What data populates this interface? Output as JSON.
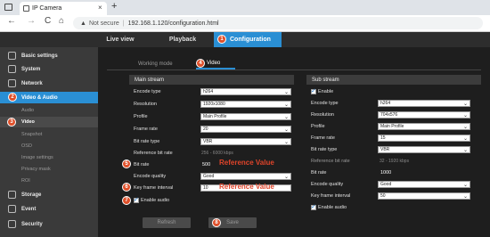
{
  "browser": {
    "tab_title": "IP Camera",
    "tab_close": "×",
    "new_tab": "+",
    "back": "←",
    "forward": "→",
    "reload": "C",
    "home": "⌂",
    "warn": "▲",
    "not_secure": "Not secure",
    "separator": "|",
    "url": "192.168.1.120/configuration.html"
  },
  "topnav": {
    "items": [
      {
        "label": "Live view"
      },
      {
        "label": "Playback"
      },
      {
        "label": "Configuration",
        "marker": "1"
      }
    ]
  },
  "sidebar": {
    "items": [
      {
        "label": "Basic settings",
        "icon": "gear-icon"
      },
      {
        "label": "System",
        "icon": "system-icon"
      },
      {
        "label": "Network",
        "icon": "network-icon"
      },
      {
        "label": "Video & Audio",
        "icon": "camera-icon",
        "marker": "2"
      },
      {
        "label": "Storage",
        "icon": "storage-icon"
      },
      {
        "label": "Event",
        "icon": "event-icon"
      },
      {
        "label": "Security",
        "icon": "security-icon"
      }
    ],
    "subitems": [
      {
        "label": "Audio"
      },
      {
        "label": "Video",
        "marker": "3"
      },
      {
        "label": "Snapshot"
      },
      {
        "label": "OSD"
      },
      {
        "label": "Image settings"
      },
      {
        "label": "Privacy mask"
      },
      {
        "label": "ROI"
      }
    ]
  },
  "content_tabs": [
    {
      "label": "Working mode"
    },
    {
      "label": "Video",
      "marker": "4"
    }
  ],
  "main_stream": {
    "title": "Main stream",
    "fields": [
      {
        "label": "Encode type",
        "value": "h264"
      },
      {
        "label": "Resolution",
        "value": "1920x1080"
      },
      {
        "label": "Profile",
        "value": "Main Profile"
      },
      {
        "label": "Frame rate",
        "value": "20"
      },
      {
        "label": "Bit rate type",
        "value": "VBR"
      }
    ],
    "ref_bitrate_label": "Reference bit rate",
    "ref_bitrate_hint": "256 - 6000 kbps",
    "bitrate_label": "Bit rate",
    "bitrate_value": "500",
    "bitrate_marker": "5",
    "quality_label": "Encode quality",
    "quality_value": "Good",
    "keyframe_label": "Key frame interval",
    "keyframe_value": "10",
    "keyframe_marker": "6",
    "enable_audio_label": "Enable audio",
    "enable_audio_marker": "7",
    "reference_value_text": "Reference Value"
  },
  "sub_stream": {
    "title": "Sub stream",
    "enable_label": "Enable",
    "fields": [
      {
        "label": "Encode type",
        "value": "h264"
      },
      {
        "label": "Resolution",
        "value": "704x576"
      },
      {
        "label": "Profile",
        "value": "Main Profile"
      },
      {
        "label": "Frame rate",
        "value": "15"
      },
      {
        "label": "Bit rate type",
        "value": "VBR"
      }
    ],
    "ref_bitrate_label": "Reference bit rate",
    "ref_bitrate_hint": "32 - 1920 kbps",
    "bitrate_label": "Bit rate",
    "bitrate_value": "1000",
    "quality_label": "Encode quality",
    "quality_value": "Good",
    "keyframe_label": "Key frame interval",
    "keyframe_value": "50",
    "enable_audio_label": "Enable audio"
  },
  "buttons": {
    "refresh": "Refresh",
    "save": "Save",
    "save_marker": "8"
  },
  "colors": {
    "accent": "#2a8fd4",
    "marker": "#e0502a",
    "reference": "#e0442a"
  }
}
